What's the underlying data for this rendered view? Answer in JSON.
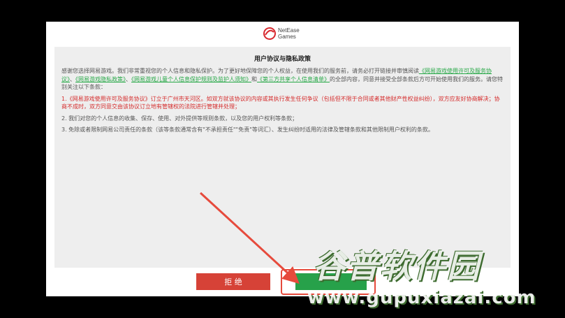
{
  "logo": {
    "line1": "NetEase",
    "line2": "Games",
    "icon": "netease-bird-logo"
  },
  "agreement": {
    "title": "用户协议与隐私政策",
    "intro_text_1": "感谢您选择网易游戏。我们非常重视您的个人信息和隐私保护。为了更好地保障您的个人权益，在使用我们的服务前，请务必打开链接并审慎阅读",
    "link_1": "《网易游戏使用许可及服务协议》",
    "sep_1": "、",
    "link_2": "《网易游戏隐私政策》",
    "sep_2": "、",
    "link_3": "《网易游戏儿童个人信息保护规则及监护人须知》",
    "sep_3": "和",
    "link_4": "《第三方共享个人信息清单》",
    "intro_text_2": "的全部内容，同意并接受全部条款后方可开始使用我们的服务。请您特别关注以下条款：",
    "clause_1": "1.《网易游戏使用许可及服务协议》订立于广州市天河区。如双方就该协议的内容或其执行发生任何争议（包括但不限于合同或者其他财产性权益纠纷），双方应友好协商解决；协商不成时，双方同意交由该协议订立地有管辖权的法院进行管辖并处理；",
    "clause_2": "2. 我们对您的个人信息的收集、保存、使用、对外提供等规则条款，以及您的用户权利等条款；",
    "clause_3": "3. 免除或者限制网易公司责任的条款（该等条款通常含有\"不承担责任\"\"免责\"等词汇）、发生纠纷时适用的法律及管辖条款和其他限制用户权利的条款。"
  },
  "buttons": {
    "reject_label": "拒 绝",
    "agree_label": ""
  },
  "watermark": {
    "main": "谷普软件园",
    "url": "www.gupuxiazai.com"
  },
  "colors": {
    "reject": "#d64237",
    "agree": "#27a14a",
    "link": "#27a847",
    "red_text": "#d52c2c",
    "annotation": "#e64a3c"
  }
}
